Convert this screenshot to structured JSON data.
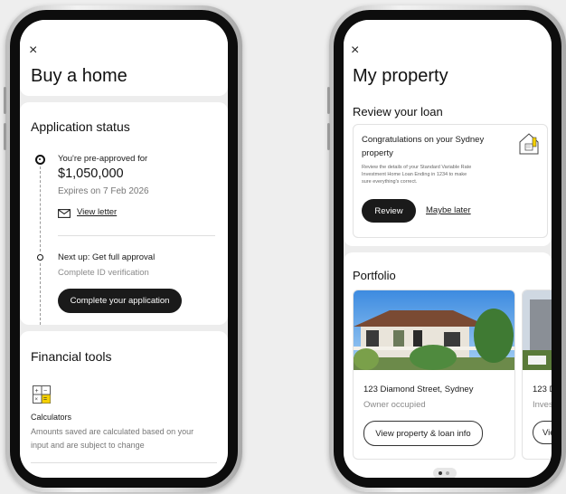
{
  "left": {
    "close_glyph": "×",
    "title": "Buy a home",
    "status": {
      "heading": "Application status",
      "step1_label": "You're pre-approved for",
      "amount": "$1,050,000",
      "expiry": "Expires on 7 Feb 2026",
      "view_letter": "View letter",
      "step2_label": "Next up: Get full approval",
      "step2_sub": "Complete ID verification",
      "complete_button": "Complete your application"
    },
    "tools": {
      "heading": "Financial tools",
      "calculators_label": "Calculators",
      "calculators_desc_1": "Amounts saved are calculated based on your",
      "calculators_desc_2": "input and are subject to change"
    }
  },
  "right": {
    "close_glyph": "×",
    "title": "My property",
    "review": {
      "heading": "Review your loan",
      "card_title_1": "Congratulations on your Sydney",
      "card_title_2": "property",
      "card_body_1": "Review the details of your Standard Variable Rate",
      "card_body_2": "Investment Home Loan Ending in 1234 to make",
      "card_body_3": "sure everything's correct.",
      "review_button": "Review",
      "maybe_later": "Maybe later"
    },
    "portfolio": {
      "heading": "Portfolio",
      "items": [
        {
          "address": "123 Diamond Street, Sydney",
          "status": "Owner occupied",
          "button": "View property & loan info"
        },
        {
          "address": "123 D",
          "status": "Invest",
          "button": "Vie"
        }
      ]
    }
  }
}
